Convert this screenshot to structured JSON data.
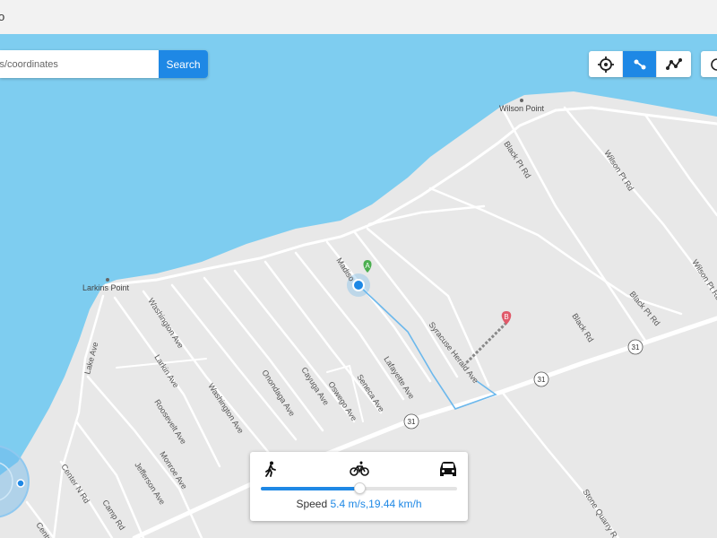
{
  "topbar": {
    "text": "o"
  },
  "search": {
    "placeholder": "ss/coordinates",
    "button_label": "Search"
  },
  "toolbar": {
    "buttons": [
      "crosshair-icon",
      "route-segment-icon",
      "multi-route-icon"
    ],
    "active_index": 1
  },
  "markers": {
    "start_label": "A",
    "end_label": "B"
  },
  "places": {
    "larkins_point": "Larkins Point",
    "wilson_point": "Wilson Point"
  },
  "streets": {
    "washington_ave_1": "Washington Ave",
    "larkin_ave": "Larkin Ave",
    "roosevelt_ave": "Roosevelt Ave",
    "monroe_ave": "Monroe Ave",
    "jefferson_ave": "Jefferson Ave",
    "washington_ave_2": "Washington Ave",
    "onondaga_ave": "Onondaga Ave",
    "cayuga_ave": "Cayuga Ave",
    "oswego_ave": "Oswego Ave",
    "seneca_ave": "Seneca Ave",
    "lafayette_ave": "Lafayette Ave",
    "madison": "Madiso",
    "syracuse_herald_ave": "Syracuse Herald Ave",
    "black_pt_rd_1": "Black Pt Rd",
    "wilson_pt_rd_1": "Wilson Pt Rd",
    "black_pt_rd_2": "Black Pt Rd",
    "black_rd": "Black Rd",
    "wilson_pt_rd_2": "Wilson Pt Rd",
    "lake_ave": "Lake Ave",
    "center_n_rd": "Center N Rd",
    "camp_rd": "Camp Rd",
    "center_rd": "Centr",
    "stone_quarry_rd": "Stone Quarry R"
  },
  "route_shields": [
    "31",
    "31",
    "31"
  ],
  "speed_panel": {
    "modes": [
      "walking-icon",
      "bicycle-icon",
      "car-icon"
    ],
    "slider_fraction": 0.5,
    "speed_label": "Speed",
    "speed_value": "5.4 m/s,19.44 km/h"
  },
  "colors": {
    "water": "#7ecdf0",
    "land": "#e8e8e8",
    "road": "#ffffff",
    "accent": "#1e88e5",
    "route": "#6cb8ec",
    "marker_a": "#4caf50",
    "marker_b": "#e05a6a"
  }
}
